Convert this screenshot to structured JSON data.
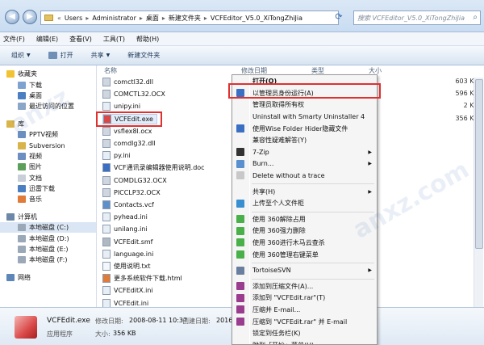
{
  "address": {
    "segments": [
      "Users",
      "Administrator",
      "桌面",
      "新建文件夹",
      "VCFEditor_V5.0_XiTongZhiJia"
    ],
    "search_placeholder": "搜索 VCFEditor_V5.0_XiTongZhiJia"
  },
  "menubar": [
    "文件(F)",
    "编辑(E)",
    "查看(V)",
    "工具(T)",
    "帮助(H)"
  ],
  "toolbar": {
    "organize": "组织",
    "open": "打开",
    "share": "共享",
    "newfolder": "新建文件夹"
  },
  "nav": {
    "favorites": "收藏夹",
    "fav_items": [
      "下载",
      "桌面",
      "最近访问的位置"
    ],
    "libraries": "库",
    "lib_items": [
      "PPTV视频",
      "Subversion",
      "视频",
      "图片",
      "文档",
      "迅雷下载",
      "音乐"
    ],
    "computer": "计算机",
    "drives": [
      "本地磁盘 (C:)",
      "本地磁盘 (D:)",
      "本地磁盘 (E:)",
      "本地磁盘 (F:)"
    ],
    "network": "网络"
  },
  "columns": {
    "name": "名称",
    "modified": "修改日期",
    "type": "类型",
    "size": "大小"
  },
  "files": [
    "comctl32.dll",
    "COMCTL32.OCX",
    "unipy.ini",
    "VCFEdit.exe",
    "vsflex8l.ocx",
    "comdlg32.dll",
    "py.ini",
    "VCF通讯录编辑器使用说明.doc",
    "COMDLG32.OCX",
    "PICCLP32.OCX",
    "Contacts.vcf",
    "pyhead.ini",
    "unilang.ini",
    "VCFEdit.smf",
    "language.ini",
    "使用说明.txt",
    "更多系统软件下载.html",
    "VCFEditX.ini",
    "VCFEdit.ini"
  ],
  "sizes": [
    "603 KB",
    "596 KB",
    "2 KB",
    "356 KB",
    "",
    "",
    "",
    "",
    "",
    "",
    "",
    "",
    "",
    "",
    "",
    "",
    "",
    "",
    ""
  ],
  "details": {
    "name": "VCFEdit.exe",
    "type": "应用程序",
    "modified_label": "修改日期:",
    "modified": "2008-08-11 10:37",
    "size_label": "大小:",
    "size": "356 KB",
    "created_label": "创建日期:",
    "created": "2016-"
  },
  "context_menu": [
    "打开(O)",
    "以管理员身份运行(A)",
    "管理员取得所有权",
    "Uninstall with Smarty Uninstaller 4",
    "使用Wise Folder Hider隐藏文件",
    "兼容性疑难解答(Y)",
    "7-Zip",
    "Burn...",
    "Delete without a trace",
    "共享(H)",
    "上传至个人文件柜",
    "使用 360解除占用",
    "使用 360强力删除",
    "使用 360进行木马云查杀",
    "使用 360管理右键菜单",
    "TortoiseSVN",
    "添加到压缩文件(A)...",
    "添加到 \"VCFEdit.rar\"(T)",
    "压缩并 E-mail...",
    "压缩到 \"VCFEdit.rar\" 并 E-mail",
    "锁定到任务栏(K)",
    "附到「开始」菜单(U)"
  ]
}
